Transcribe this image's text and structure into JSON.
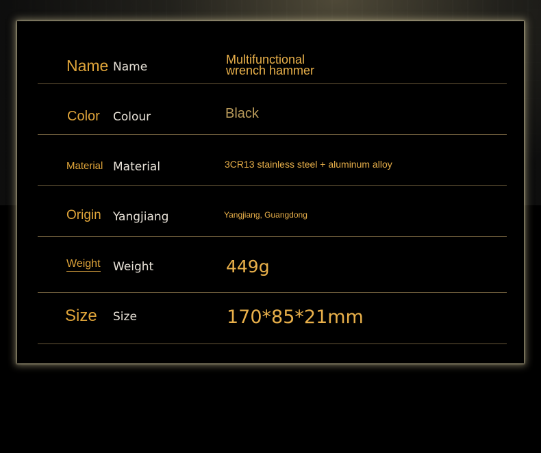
{
  "colors": {
    "label_gold": "#e0a53a",
    "value_gold": "#e9b04a",
    "value_muted": "#b89a5a",
    "divider": "#6b5a3a",
    "secondary_text": "#e8e2d8",
    "panel_glow": "#d8cca0"
  },
  "specs": [
    {
      "label": "Name",
      "label_alt": "Name",
      "value_line1": "Multifunctional",
      "value_line2": "wrench hammer"
    },
    {
      "label": "Color",
      "label_alt": "Colour",
      "value": "Black"
    },
    {
      "label": "Material",
      "label_alt": "Material",
      "value": "3CR13 stainless steel + aluminum alloy"
    },
    {
      "label": "Origin",
      "label_alt": "Yangjiang",
      "value": "Yangjiang, Guangdong"
    },
    {
      "label": "Weight",
      "label_alt": "Weight",
      "value": "449g"
    },
    {
      "label": "Size",
      "label_alt": "Size",
      "value": "170*85*21mm"
    }
  ]
}
